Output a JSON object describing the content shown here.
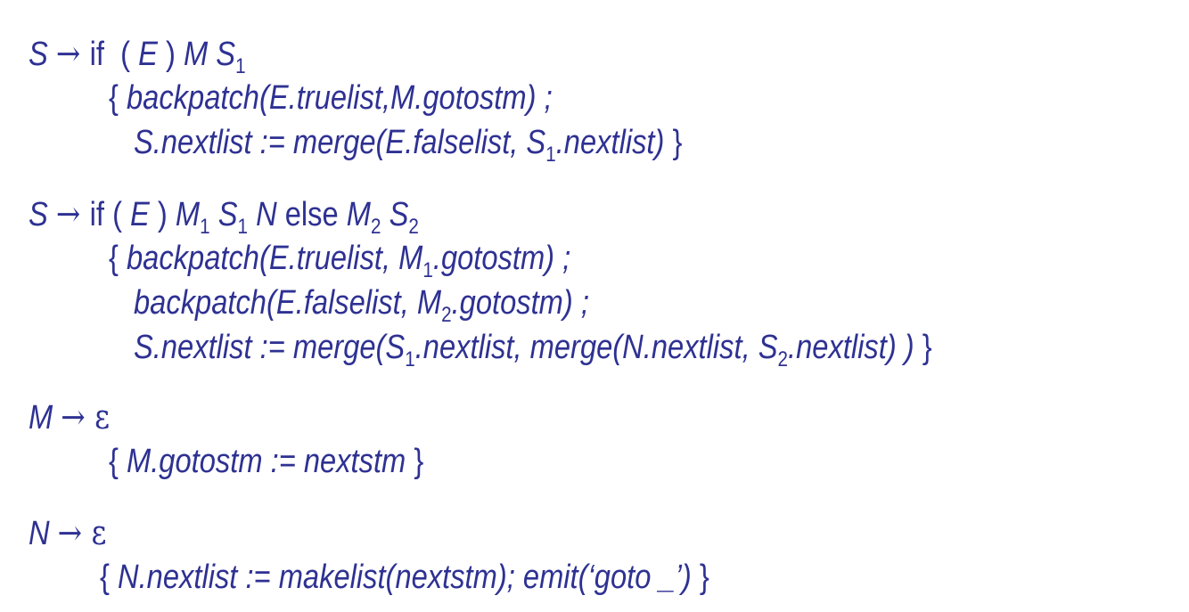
{
  "text_color": "#2e3192",
  "lines": [
    {
      "segs": [
        {
          "t": "S ",
          "i": true
        },
        {
          "t": "→ ",
          "sym": true
        },
        {
          "t": "if  ( "
        },
        {
          "t": "E",
          "i": true
        },
        {
          "t": " ) "
        },
        {
          "t": "M S",
          "i": true
        },
        {
          "t": "1",
          "sub": true
        }
      ]
    },
    {
      "segs": [
        {
          "t": "{ "
        },
        {
          "t": "backpatch(E.truelist,M.gotostm) ;",
          "i": true
        }
      ]
    },
    {
      "segs": [
        {
          "t": "S.nextlist := merge(E.falselist, S",
          "i": true
        },
        {
          "t": "1",
          "sub": true
        },
        {
          "t": ".nextlist)",
          "i": true
        },
        {
          "t": " }"
        }
      ]
    },
    {
      "segs": [
        {
          "t": "S ",
          "i": true
        },
        {
          "t": "→ ",
          "sym": true
        },
        {
          "t": "if ( "
        },
        {
          "t": "E",
          "i": true
        },
        {
          "t": " ) "
        },
        {
          "t": "M",
          "i": true
        },
        {
          "t": "1",
          "sub": true
        },
        {
          "t": " S",
          "i": true
        },
        {
          "t": "1",
          "sub": true
        },
        {
          "t": " N",
          "i": true
        },
        {
          "t": " else "
        },
        {
          "t": "M",
          "i": true
        },
        {
          "t": "2",
          "sub": true
        },
        {
          "t": " S",
          "i": true
        },
        {
          "t": "2",
          "sub": true
        }
      ]
    },
    {
      "segs": [
        {
          "t": "{ "
        },
        {
          "t": "backpatch(E.truelist, M",
          "i": true
        },
        {
          "t": "1",
          "sub": true
        },
        {
          "t": ".gotostm) ;",
          "i": true
        }
      ]
    },
    {
      "segs": [
        {
          "t": "backpatch(E.falselist, M",
          "i": true
        },
        {
          "t": "2",
          "sub": true
        },
        {
          "t": ".gotostm) ;",
          "i": true
        }
      ]
    },
    {
      "segs": [
        {
          "t": "S.nextlist := merge(S",
          "i": true
        },
        {
          "t": "1",
          "sub": true
        },
        {
          "t": ".nextlist, merge(N.nextlist, S",
          "i": true
        },
        {
          "t": "2",
          "sub": true
        },
        {
          "t": ".nextlist) )",
          "i": true
        },
        {
          "t": " }"
        }
      ]
    },
    {
      "segs": [
        {
          "t": "M ",
          "i": true
        },
        {
          "t": "→ ε",
          "sym": true
        }
      ]
    },
    {
      "segs": [
        {
          "t": "{ "
        },
        {
          "t": "M.gotostm := nextstm",
          "i": true
        },
        {
          "t": " }"
        }
      ]
    },
    {
      "segs": [
        {
          "t": "N ",
          "i": true
        },
        {
          "t": "→ ε",
          "sym": true
        }
      ]
    },
    {
      "segs": [
        {
          "t": "{ "
        },
        {
          "t": "N.nextlist := makelist(nextstm); emit(‘goto _’)",
          "i": true
        },
        {
          "t": " }"
        }
      ]
    }
  ]
}
